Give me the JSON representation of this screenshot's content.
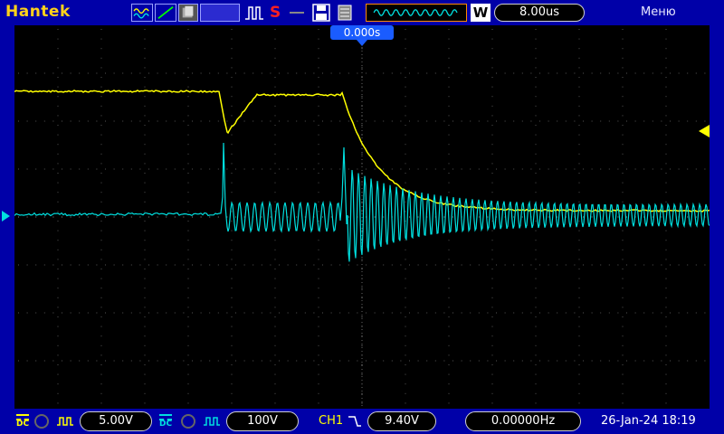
{
  "app": {
    "brand": "Hantek",
    "menu_label": "Меню"
  },
  "toolbar": {
    "w_label": "W",
    "timebase": "8.00us",
    "trigger_time": "0.000s",
    "stop_label": "S"
  },
  "channels": {
    "ch1": {
      "coupling": "DC",
      "scale": "5.00V",
      "color": "#ffff00"
    },
    "ch2": {
      "coupling": "DC",
      "scale": "100V",
      "color": "#00e0e0"
    }
  },
  "trigger": {
    "source": "CH1",
    "level": "9.40V",
    "frequency": "0.00000Hz"
  },
  "status": {
    "datetime": "26-Jan-24 18:19"
  },
  "icons": [
    "waveform-icon",
    "slope-icon",
    "persist-icon",
    "pulse-icon",
    "stop-icon",
    "save-icon",
    "memory-icon",
    "window-icon"
  ]
}
